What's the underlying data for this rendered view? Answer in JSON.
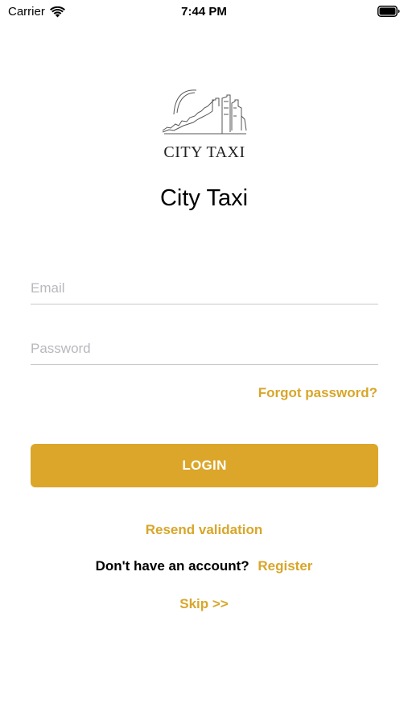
{
  "status_bar": {
    "carrier": "Carrier",
    "time": "7:44 PM"
  },
  "logo": {
    "text": "CITY TAXI"
  },
  "app_title": "City Taxi",
  "form": {
    "email_placeholder": "Email",
    "email_value": "",
    "password_placeholder": "Password",
    "password_value": "",
    "forgot_password": "Forgot password?",
    "login_label": "LOGIN"
  },
  "links": {
    "resend_validation": "Resend validation",
    "no_account_prompt": "Don't have an account?",
    "register": "Register",
    "skip": "Skip >>"
  },
  "colors": {
    "accent": "#dba62a",
    "link": "#d8a62a",
    "divider": "#c9c9c9"
  }
}
